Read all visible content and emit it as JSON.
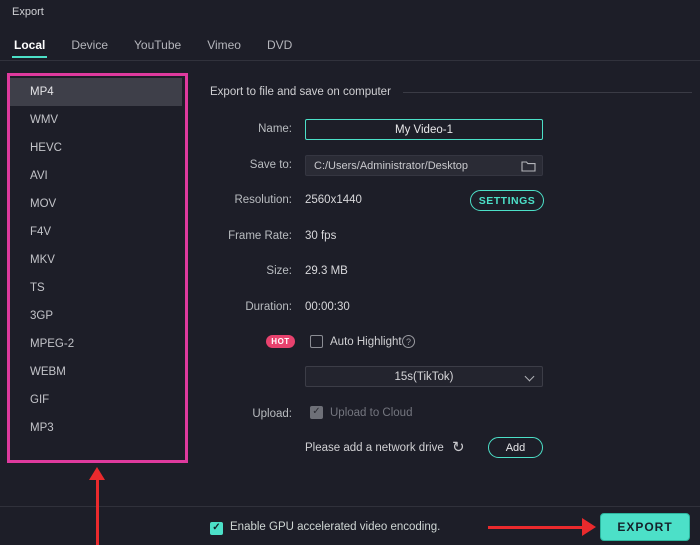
{
  "window": {
    "title": "Export"
  },
  "tabs": [
    {
      "label": "Local",
      "active": true
    },
    {
      "label": "Device",
      "active": false
    },
    {
      "label": "YouTube",
      "active": false
    },
    {
      "label": "Vimeo",
      "active": false
    },
    {
      "label": "DVD",
      "active": false
    }
  ],
  "sidebar": {
    "selected": "MP4",
    "formats": [
      "MP4",
      "WMV",
      "HEVC",
      "AVI",
      "MOV",
      "F4V",
      "MKV",
      "TS",
      "3GP",
      "MPEG-2",
      "WEBM",
      "GIF",
      "MP3"
    ]
  },
  "main": {
    "section_title": "Export to file and save on computer",
    "fields": {
      "name_label": "Name:",
      "name_value": "My Video-1",
      "save_to_label": "Save to:",
      "save_to_value": "C:/Users/Administrator/Desktop",
      "resolution_label": "Resolution:",
      "resolution_value": "2560x1440",
      "settings_button": "SETTINGS",
      "frame_rate_label": "Frame Rate:",
      "frame_rate_value": "30 fps",
      "size_label": "Size:",
      "size_value": "29.3 MB",
      "duration_label": "Duration:",
      "duration_value": "00:00:30",
      "hot_badge": "HOT",
      "auto_highlight_label": "Auto Highlight",
      "question_mark": "?",
      "duration_preset": "15s(TikTok)",
      "upload_label": "Upload:",
      "upload_to_cloud_label": "Upload to Cloud",
      "network_drive_text": "Please add a network drive",
      "add_button": "Add",
      "check_glyph": "✓",
      "refresh_glyph": "↻"
    }
  },
  "footer": {
    "gpu_label": "Enable GPU accelerated video encoding.",
    "export_button": "EXPORT"
  },
  "colors": {
    "accent": "#4ce0c8",
    "annotation_box": "#df3a9e",
    "annotation_arrow": "#ea2a2d",
    "hot_badge": "#e8426e",
    "selected_row": "#3e3f49"
  }
}
